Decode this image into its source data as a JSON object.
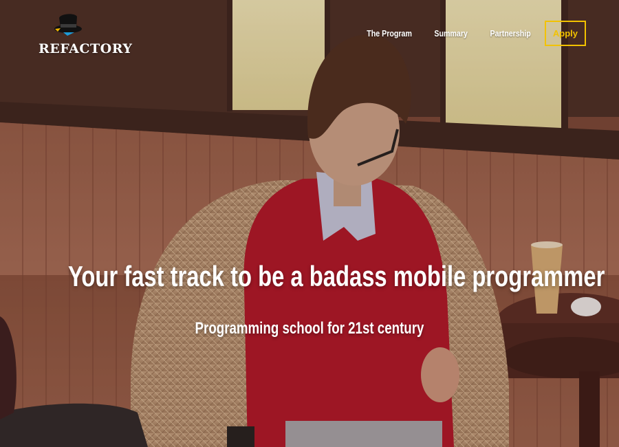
{
  "brand": {
    "name": "Refactory",
    "display_text": "REFACTORY"
  },
  "nav": {
    "items": [
      {
        "label": "The Program"
      },
      {
        "label": "Summary"
      },
      {
        "label": "Partnership"
      }
    ],
    "apply_label": "Apply"
  },
  "hero": {
    "title": "Your fast track to be a badass mobile programmer",
    "subtitle": "Programming school for 21st century"
  },
  "colors": {
    "accent": "#f2c200",
    "text": "#ffffff"
  }
}
